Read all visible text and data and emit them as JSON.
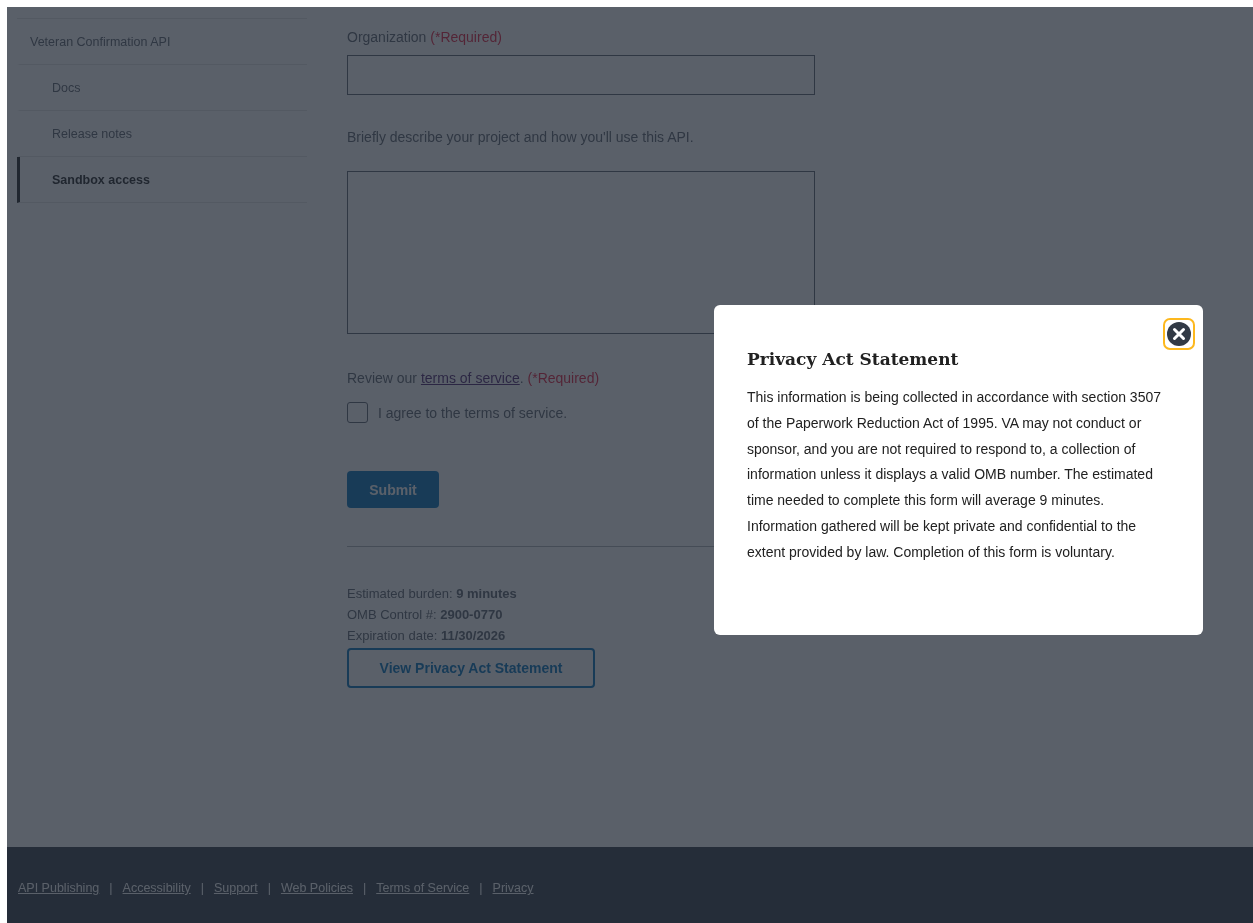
{
  "sidebar": {
    "items": [
      {
        "label": "Veteran Confirmation API",
        "selected": false,
        "children": [
          {
            "label": "Docs",
            "selected": false
          },
          {
            "label": "Release notes",
            "selected": false
          },
          {
            "label": "Sandbox access",
            "selected": true
          }
        ]
      }
    ]
  },
  "form": {
    "fields": [
      {
        "kind": "input",
        "label": "Organization",
        "required_note": "(*Required)"
      },
      {
        "kind": "textarea",
        "label": "Briefly describe your project and how you'll use this API."
      }
    ],
    "terms": {
      "prefix": "Review our ",
      "link": "terms of service",
      "suffix": ".",
      "required_note": "(*Required)"
    },
    "checkbox": {
      "label": "I agree to the terms of service.",
      "checked": false
    },
    "submit": "Submit",
    "burden": [
      "Estimated burden: **9 minutes**",
      "OMB Control #: **2900-0770**",
      "Expiration date: **11/30/2026**"
    ],
    "privacy_button": "View Privacy Act Statement"
  },
  "modal": {
    "title": "Privacy Act Statement",
    "close_focused": true,
    "body": "This information is being collected in accordance with section 3507 of the Paperwork Reduction Act of 1995. VA may not conduct or sponsor, and you are not required to respond to, a collection of information unless it displays a valid OMB number. The estimated time needed to complete this form will average 9 minutes. Information gathered will be kept private and confidential to the extent provided by law. Completion of this form is voluntary."
  },
  "footer": {
    "separator": "|",
    "links": [
      "API Publishing",
      "Accessibility",
      "Support",
      "Web Policies",
      "Terms of Service",
      "Privacy"
    ]
  }
}
